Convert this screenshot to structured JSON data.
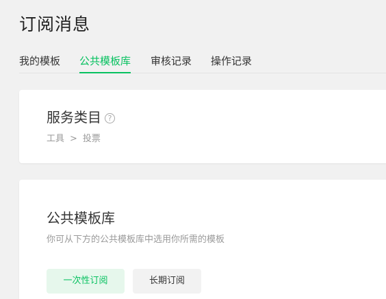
{
  "page": {
    "title": "订阅消息"
  },
  "tabs": [
    {
      "label": "我的模板",
      "active": false
    },
    {
      "label": "公共模板库",
      "active": true
    },
    {
      "label": "审核记录",
      "active": false
    },
    {
      "label": "操作记录",
      "active": false
    }
  ],
  "service": {
    "title": "服务类目",
    "help_icon": "question-circle-icon",
    "help_glyph": "?",
    "breadcrumb": {
      "first": "工具",
      "separator": ">",
      "second": "投票"
    }
  },
  "library": {
    "title": "公共模板库",
    "description": "你可从下方的公共模板库中选用你所需的模板",
    "filters": [
      {
        "label": "一次性订阅",
        "active": true
      },
      {
        "label": "长期订阅",
        "active": false
      }
    ]
  },
  "colors": {
    "accent": "#07c160",
    "accent_light_bg": "#e6f7ec",
    "background": "#f1f1f1",
    "card": "#ffffff",
    "muted_text": "#9a9a9a"
  }
}
